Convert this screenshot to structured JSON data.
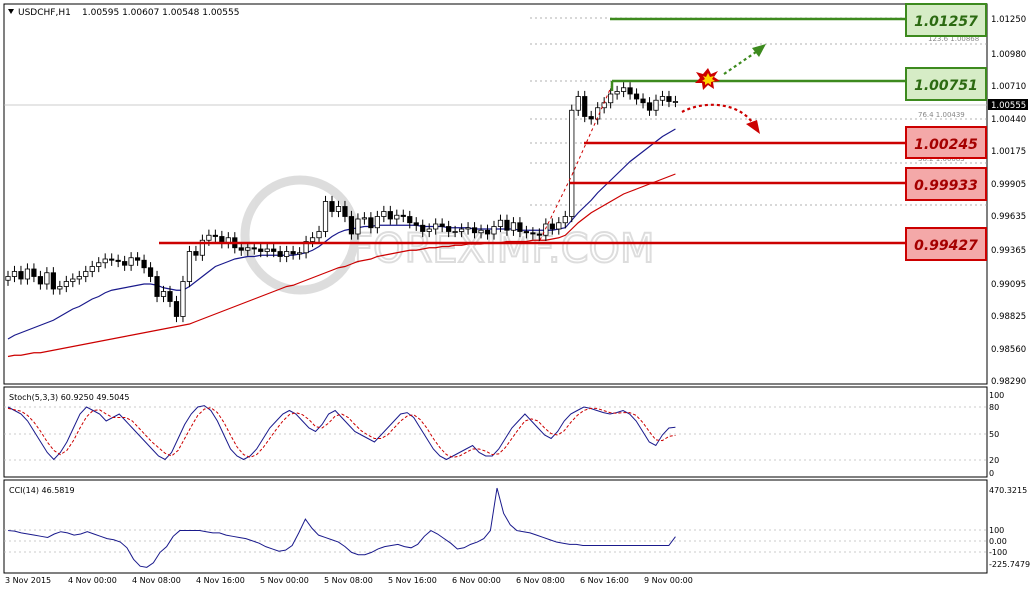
{
  "header": {
    "symbol": "USDCHF,H1",
    "ohlc": "1.00595 1.00607 1.00548 1.00555"
  },
  "watermark": "FOREXIMF.COM",
  "price_axis_labels": [
    "1.01250",
    "1.00980",
    "1.00710",
    "1.00440",
    "1.00175",
    "0.99905",
    "0.99635",
    "0.99365",
    "0.99095",
    "0.98825",
    "0.98560",
    "0.98290"
  ],
  "current_price_label": "1.00555",
  "fib_labels": [
    "123.6 1.00868",
    "76.4  1.00439",
    "38.2 1.00083"
  ],
  "levels": [
    {
      "value": "1.01257",
      "kind": "resistance",
      "color": "#3d8a1e"
    },
    {
      "value": "1.00751",
      "kind": "resistance",
      "color": "#3d8a1e"
    },
    {
      "value": "1.00245",
      "kind": "support",
      "color": "#cc0000"
    },
    {
      "value": "0.99933",
      "kind": "support",
      "color": "#cc0000"
    },
    {
      "value": "0.99427",
      "kind": "support",
      "color": "#cc0000"
    }
  ],
  "stoch": {
    "label": "Stoch(5,3,3) 60.9250 49.5045",
    "axis": [
      "100",
      "80",
      "50",
      "20",
      "0"
    ]
  },
  "cci": {
    "label": "CCI(14) 46.5819",
    "axis": [
      "470.3215",
      "100",
      "0.00",
      "-100",
      "-225.7479"
    ]
  },
  "time_labels": [
    "3 Nov 2015",
    "4 Nov 00:00",
    "4 Nov 08:00",
    "4 Nov 16:00",
    "5 Nov 00:00",
    "5 Nov 08:00",
    "5 Nov 16:00",
    "6 Nov 00:00",
    "6 Nov 08:00",
    "6 Nov 16:00",
    "9 Nov 00:00"
  ],
  "colors": {
    "bull": "#3d8a1e",
    "bear": "#cc0000",
    "ma_fast": "#1a1a8c",
    "ma_slow": "#cc0000",
    "candle": "#000000"
  },
  "chart_data": {
    "type": "candlestick",
    "symbol": "USDCHF",
    "timeframe": "H1",
    "ylim": [
      0.9829,
      1.0133
    ],
    "candles_close": [
      0.9915,
      0.9919,
      0.9913,
      0.9921,
      0.9915,
      0.9909,
      0.9918,
      0.9905,
      0.9907,
      0.9911,
      0.9913,
      0.9915,
      0.9919,
      0.9923,
      0.9926,
      0.9929,
      0.9928,
      0.9927,
      0.9924,
      0.993,
      0.9928,
      0.9922,
      0.9915,
      0.9899,
      0.9903,
      0.9895,
      0.9883,
      0.9911,
      0.9935,
      0.9932,
      0.9944,
      0.9948,
      0.9947,
      0.9942,
      0.9946,
      0.9938,
      0.9936,
      0.9938,
      0.9937,
      0.9935,
      0.9937,
      0.9935,
      0.9931,
      0.9935,
      0.9933,
      0.9934,
      0.9943,
      0.9946,
      0.9951,
      0.9975,
      0.9967,
      0.9971,
      0.9963,
      0.9949,
      0.9961,
      0.9962,
      0.9954,
      0.9963,
      0.9967,
      0.9961,
      0.9964,
      0.9963,
      0.9958,
      0.9956,
      0.9951,
      0.9953,
      0.9957,
      0.9955,
      0.9951,
      0.9951,
      0.9953,
      0.9954,
      0.995,
      0.9952,
      0.9949,
      0.9955,
      0.996,
      0.9952,
      0.9958,
      0.9951,
      0.995,
      0.9949,
      0.9948,
      0.9957,
      0.9953,
      0.9958,
      0.9963,
      1.0048,
      1.0059,
      1.0043,
      1.0041,
      1.005,
      1.0054,
      1.0061,
      1.0063,
      1.0066,
      1.0061,
      1.0057,
      1.0054,
      1.0048,
      1.0056,
      1.0059,
      1.0055,
      1.0055
    ],
    "series": [
      {
        "name": "MA fast",
        "values": [
          0.9865,
          0.9868,
          0.987,
          0.9872,
          0.9874,
          0.9876,
          0.9878,
          0.988,
          0.9883,
          0.9886,
          0.9889,
          0.9891,
          0.9894,
          0.9897,
          0.9899,
          0.9902,
          0.9904,
          0.9905,
          0.9906,
          0.9907,
          0.9908,
          0.9909,
          0.9909,
          0.9908,
          0.9906,
          0.9905,
          0.9904,
          0.9904,
          0.9907,
          0.9911,
          0.9915,
          0.9919,
          0.9923,
          0.9925,
          0.9927,
          0.9929,
          0.993,
          0.9931,
          0.9931,
          0.9932,
          0.9932,
          0.9932,
          0.9932,
          0.9932,
          0.9932,
          0.9933,
          0.9934,
          0.9936,
          0.9939,
          0.9943,
          0.9947,
          0.995,
          0.9952,
          0.9953,
          0.9954,
          0.9955,
          0.9955,
          0.9956,
          0.9956,
          0.9956,
          0.9956,
          0.9956,
          0.9956,
          0.9956,
          0.9955,
          0.9955,
          0.9955,
          0.9955,
          0.9954,
          0.9954,
          0.9954,
          0.9954,
          0.9953,
          0.9953,
          0.9953,
          0.9953,
          0.9953,
          0.9953,
          0.9953,
          0.9952,
          0.9952,
          0.9952,
          0.9952,
          0.9952,
          0.9952,
          0.9953,
          0.9954,
          0.996,
          0.9966,
          0.9971,
          0.9976,
          0.9982,
          0.9987,
          0.9992,
          0.9997,
          1.0002,
          1.0007,
          1.0011,
          1.0015,
          1.0019,
          1.0023,
          1.0027,
          1.003,
          1.0033
        ]
      },
      {
        "name": "MA slow",
        "values": [
          0.9851,
          0.9852,
          0.9852,
          0.9853,
          0.9854,
          0.9854,
          0.9855,
          0.9856,
          0.9857,
          0.9858,
          0.9859,
          0.986,
          0.9861,
          0.9862,
          0.9863,
          0.9864,
          0.9865,
          0.9866,
          0.9867,
          0.9868,
          0.9869,
          0.987,
          0.9871,
          0.9872,
          0.9873,
          0.9874,
          0.9875,
          0.9876,
          0.9877,
          0.9879,
          0.9881,
          0.9883,
          0.9885,
          0.9887,
          0.9889,
          0.9891,
          0.9893,
          0.9895,
          0.9897,
          0.9899,
          0.9901,
          0.9903,
          0.9905,
          0.9907,
          0.9908,
          0.991,
          0.9912,
          0.9914,
          0.9916,
          0.9918,
          0.992,
          0.9922,
          0.9923,
          0.9925,
          0.9927,
          0.9928,
          0.9929,
          0.9931,
          0.9932,
          0.9933,
          0.9934,
          0.9935,
          0.9936,
          0.9936,
          0.9937,
          0.9938,
          0.9938,
          0.9939,
          0.9939,
          0.994,
          0.994,
          0.9941,
          0.9941,
          0.9941,
          0.9942,
          0.9942,
          0.9942,
          0.9943,
          0.9943,
          0.9943,
          0.9943,
          0.9944,
          0.9944,
          0.9944,
          0.9945,
          0.9946,
          0.9948,
          0.9953,
          0.9958,
          0.9962,
          0.9966,
          0.9969,
          0.9972,
          0.9975,
          0.9978,
          0.9981,
          0.9983,
          0.9985,
          0.9987,
          0.9989,
          0.9991,
          0.9993,
          0.9995,
          0.9997
        ]
      },
      {
        "name": "Stoch main",
        "values": [
          90,
          85,
          80,
          70,
          55,
          40,
          25,
          15,
          25,
          40,
          60,
          80,
          90,
          85,
          80,
          70,
          75,
          80,
          70,
          60,
          50,
          40,
          30,
          20,
          15,
          25,
          45,
          65,
          80,
          90,
          92,
          85,
          70,
          50,
          30,
          20,
          15,
          20,
          30,
          45,
          60,
          70,
          80,
          85,
          80,
          70,
          60,
          55,
          65,
          80,
          85,
          75,
          65,
          55,
          50,
          45,
          40,
          50,
          60,
          70,
          80,
          82,
          75,
          60,
          45,
          30,
          20,
          15,
          20,
          25,
          30,
          35,
          25,
          20,
          20,
          30,
          45,
          60,
          70,
          80,
          70,
          60,
          50,
          45,
          55,
          70,
          80,
          85,
          90,
          88,
          85,
          82,
          80,
          82,
          85,
          80,
          70,
          55,
          40,
          35,
          50,
          60,
          61
        ]
      },
      {
        "name": "Stoch signal",
        "values": [
          88,
          86,
          84,
          78,
          68,
          55,
          40,
          28,
          22,
          28,
          42,
          60,
          76,
          85,
          86,
          80,
          75,
          75,
          75,
          70,
          60,
          50,
          40,
          32,
          24,
          20,
          28,
          45,
          62,
          78,
          87,
          89,
          82,
          68,
          50,
          33,
          22,
          18,
          22,
          32,
          45,
          58,
          70,
          79,
          82,
          79,
          72,
          62,
          60,
          67,
          77,
          80,
          75,
          65,
          56,
          50,
          45,
          45,
          50,
          60,
          70,
          77,
          79,
          72,
          60,
          45,
          32,
          22,
          18,
          20,
          25,
          30,
          30,
          27,
          22,
          23,
          32,
          45,
          58,
          70,
          73,
          70,
          60,
          52,
          50,
          56,
          68,
          78,
          85,
          88,
          88,
          85,
          82,
          81,
          82,
          82,
          78,
          68,
          55,
          43,
          42,
          48,
          49.5
        ]
      },
      {
        "name": "CCI",
        "values": [
          100,
          95,
          80,
          70,
          60,
          50,
          40,
          70,
          90,
          80,
          60,
          70,
          90,
          70,
          50,
          30,
          20,
          0,
          -50,
          -150,
          -210,
          -220,
          -180,
          -90,
          -40,
          50,
          100,
          100,
          100,
          100,
          90,
          80,
          80,
          60,
          50,
          40,
          30,
          10,
          -10,
          -40,
          -60,
          -80,
          -70,
          -30,
          80,
          200,
          120,
          60,
          40,
          20,
          0,
          -40,
          -90,
          -110,
          -110,
          -90,
          -60,
          -40,
          -30,
          -20,
          -40,
          -50,
          -20,
          50,
          100,
          70,
          30,
          -10,
          -60,
          -50,
          -20,
          0,
          30,
          100,
          470,
          250,
          150,
          100,
          90,
          80,
          60,
          40,
          20,
          0,
          -10,
          -20,
          -20,
          -30,
          -30,
          -30,
          -30,
          -30,
          -30,
          -30,
          -30,
          -30,
          -30,
          -30,
          -30,
          -30,
          -30,
          46.58
        ]
      }
    ]
  }
}
